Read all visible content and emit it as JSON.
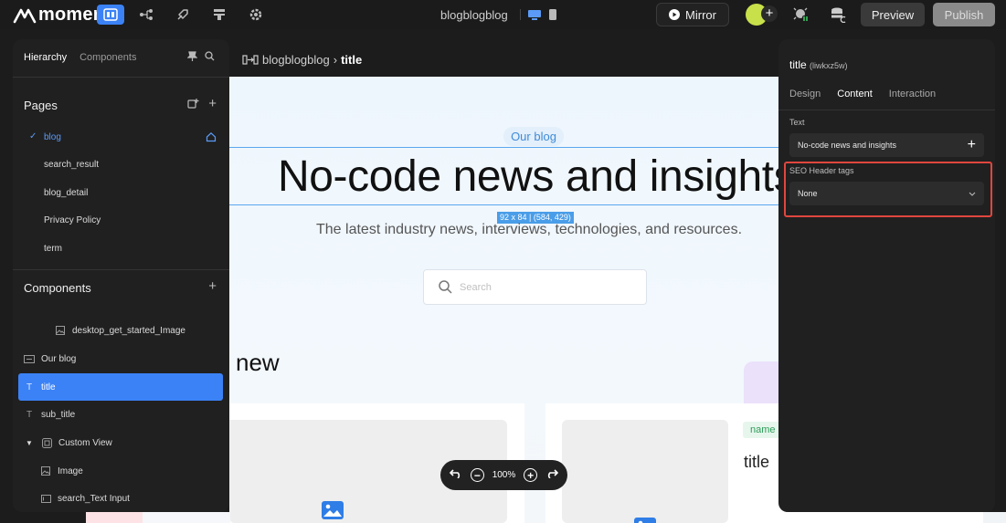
{
  "topbar": {
    "logo_text": "momen",
    "project_name": "blogblogblog",
    "mirror_label": "Mirror",
    "preview_label": "Preview",
    "publish_label": "Publish",
    "avatar_plus": "+"
  },
  "left_panel": {
    "tabs": [
      "Hierarchy",
      "Components"
    ],
    "pages_title": "Pages",
    "pages": [
      "blog",
      "search_result",
      "blog_detail",
      "Privacy Policy",
      "term"
    ],
    "components_title": "Components",
    "components": [
      {
        "label": "desktop_get_started_Image",
        "icon": "image-icon"
      },
      {
        "label": "Our blog",
        "icon": "html-icon"
      },
      {
        "label": "title",
        "icon": "text-icon"
      },
      {
        "label": "sub_title",
        "icon": "text-icon"
      },
      {
        "label": "Custom View",
        "icon": "view-icon"
      },
      {
        "label": "Image",
        "icon": "image-icon"
      },
      {
        "label": "search_Text Input",
        "icon": "input-icon"
      }
    ]
  },
  "breadcrumb": {
    "page": "blogblogblog",
    "separator": "›",
    "current": "title"
  },
  "canvas": {
    "badge": "Our blog",
    "title": "No-code news and insights",
    "size_tag": "92 x 84 | (584, 429)",
    "subtitle": "The latest industry news, interviews, technologies, and resources.",
    "search_placeholder": "Search",
    "section_heading": "new",
    "card_name_tag": "name",
    "card_title": "title"
  },
  "zoom": {
    "level": "100%"
  },
  "right_panel": {
    "element_name": "title",
    "element_id": "(liwkxz5w)",
    "tabs": [
      "Design",
      "Content",
      "Interaction"
    ],
    "active_tab": "Content",
    "text_label": "Text",
    "text_value": "No-code news and insights",
    "seo_label": "SEO Header tags",
    "seo_value": "None"
  },
  "colors": {
    "accent": "#3b82f6",
    "highlight": "#e0463f",
    "canvas_bg": "#eef6fd"
  }
}
